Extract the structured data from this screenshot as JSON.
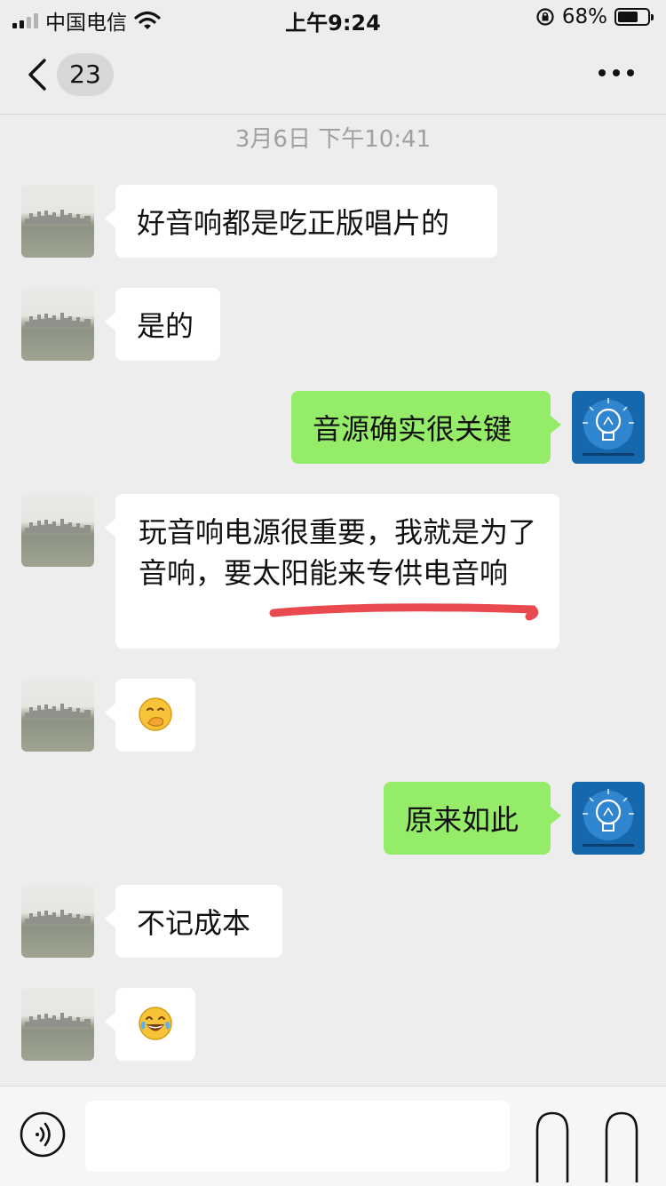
{
  "status_bar": {
    "carrier": "中国电信",
    "time": "上午9:24",
    "battery_percent": "68%",
    "battery_level": 0.68
  },
  "nav": {
    "unread_count": "23",
    "title": ""
  },
  "timestamp": "3月6日 下午10:41",
  "messages": [
    {
      "side": "left",
      "text": "好音响都是吃正版唱片的"
    },
    {
      "side": "left",
      "text": "是的"
    },
    {
      "side": "right",
      "text": "音源确实很关键"
    },
    {
      "side": "left",
      "text": "玩音响电源很重要，我就是为了音响，要太阳能来专供电音响"
    },
    {
      "side": "left",
      "emoji": "hand-over-mouth-emoji"
    },
    {
      "side": "right",
      "text": "原来如此"
    },
    {
      "side": "left",
      "text": "不记成本"
    },
    {
      "side": "left",
      "emoji": "tears-of-joy-emoji"
    }
  ],
  "colors": {
    "self_bubble": "#95ec69",
    "other_bubble": "#ffffff",
    "background": "#ededed",
    "annotation_underline": "#e84a4f"
  },
  "icons": {
    "back": "chevron-left-icon",
    "more": "more-dots-icon",
    "voice": "voice-icon",
    "emoji": "emoji-icon",
    "plus": "plus-icon",
    "self_avatar": "lightbulb-logo-icon"
  }
}
